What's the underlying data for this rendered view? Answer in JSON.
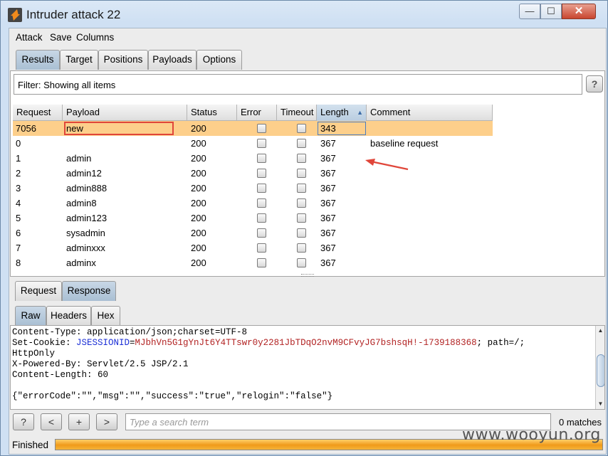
{
  "window": {
    "title": "Intruder attack 22",
    "min_label": "—",
    "max_label": "☐",
    "close_label": "✕"
  },
  "menu": [
    "Attack",
    "Save",
    "Columns"
  ],
  "main_tabs": [
    {
      "label": "Results",
      "active": true
    },
    {
      "label": "Target",
      "active": false
    },
    {
      "label": "Positions",
      "active": false
    },
    {
      "label": "Payloads",
      "active": false
    },
    {
      "label": "Options",
      "active": false
    }
  ],
  "filter": {
    "text": "Filter: Showing all items",
    "help_label": "?"
  },
  "table": {
    "columns": [
      "Request",
      "Payload",
      "Status",
      "Error",
      "Timeout",
      "Length",
      "Comment"
    ],
    "sort_indicator": "▲",
    "rows": [
      {
        "request": "7056",
        "payload": "new",
        "status": "200",
        "length": "343",
        "comment": "",
        "selected": true
      },
      {
        "request": "0",
        "payload": "",
        "status": "200",
        "length": "367",
        "comment": "baseline request",
        "selected": false
      },
      {
        "request": "1",
        "payload": "admin",
        "status": "200",
        "length": "367",
        "comment": "",
        "selected": false
      },
      {
        "request": "2",
        "payload": "admin12",
        "status": "200",
        "length": "367",
        "comment": "",
        "selected": false
      },
      {
        "request": "3",
        "payload": "admin888",
        "status": "200",
        "length": "367",
        "comment": "",
        "selected": false
      },
      {
        "request": "4",
        "payload": "admin8",
        "status": "200",
        "length": "367",
        "comment": "",
        "selected": false
      },
      {
        "request": "5",
        "payload": "admin123",
        "status": "200",
        "length": "367",
        "comment": "",
        "selected": false
      },
      {
        "request": "6",
        "payload": "sysadmin",
        "status": "200",
        "length": "367",
        "comment": "",
        "selected": false
      },
      {
        "request": "7",
        "payload": "adminxxx",
        "status": "200",
        "length": "367",
        "comment": "",
        "selected": false
      },
      {
        "request": "8",
        "payload": "adminx",
        "status": "200",
        "length": "367",
        "comment": "",
        "selected": false
      }
    ]
  },
  "detail_tabs": [
    {
      "label": "Request",
      "active": false
    },
    {
      "label": "Response",
      "active": true
    }
  ],
  "view_tabs": [
    {
      "label": "Raw",
      "active": true
    },
    {
      "label": "Headers",
      "active": false
    },
    {
      "label": "Hex",
      "active": false
    }
  ],
  "response": {
    "line1": "Content-Type: application/json;charset=UTF-8",
    "cookie_prefix": "Set-Cookie: ",
    "cookie_name": "JSESSIONID",
    "cookie_eq": "=",
    "cookie_value": "MJbhVn5G1gYnJt6Y4TTswr0y2281JbTDqO2nvM9CFvyJG7bshsqH!-1739188368",
    "cookie_suffix": "; path=/;",
    "line3": "HttpOnly",
    "line4": "X-Powered-By: Servlet/2.5 JSP/2.1",
    "line5": "Content-Length: 60",
    "body": "{\"errorCode\":\"\",\"msg\":\"\",\"success\":\"true\",\"relogin\":\"false\"}"
  },
  "search": {
    "help_label": "?",
    "prev_label": "<",
    "add_label": "+",
    "next_label": ">",
    "placeholder": "Type a search term",
    "matches": "0 matches"
  },
  "status": {
    "text": "Finished",
    "progress": 1.0
  },
  "watermark": "www.wooyun.org",
  "colors": {
    "selected_row": "#fdcf8b",
    "highlight_border": "#e0463a",
    "progress": "#f09a1a"
  }
}
